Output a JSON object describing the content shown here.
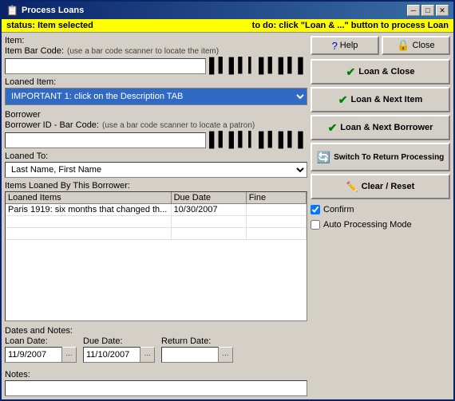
{
  "window": {
    "title": "Process Loans",
    "title_icon": "📋"
  },
  "status": {
    "left": "status: Item selected",
    "right": "to do: click \"Loan & ...\" button to process Loan"
  },
  "item_section": {
    "label": "Item:",
    "barcode_label": "Item Bar Code:",
    "barcode_note": "(use a bar code scanner to locate the item)",
    "barcode_value": "",
    "barcode_icon": "▌▌▌▌▌▌▌▌▌▌"
  },
  "loaned_item": {
    "label": "Loaned Item:",
    "value": "IMPORTANT 1:   click on the Description TAB"
  },
  "borrower_section": {
    "label": "Borrower",
    "barcode_label": "Borrower ID - Bar Code:",
    "barcode_note": "(use a bar code scanner to locate a patron)",
    "barcode_value": "",
    "loaned_to_label": "Loaned To:",
    "loaned_to_placeholder": "Last Name, First Name",
    "loaned_to_value": ""
  },
  "items_table": {
    "section_label": "Items Loaned By This Borrower:",
    "columns": [
      "Loaned Items",
      "Due Date",
      "Fine"
    ],
    "rows": [
      {
        "item": "Paris 1919: six months that changed th...",
        "due_date": "10/30/2007",
        "fine": ""
      }
    ]
  },
  "dates_section": {
    "label": "Dates and Notes:",
    "loan_date_label": "Loan Date:",
    "loan_date_value": "11/9/2007",
    "due_date_label": "Due Date:",
    "due_date_value": "11/10/2007",
    "return_date_label": "Return Date:",
    "return_date_value": "",
    "notes_label": "Notes:",
    "notes_value": ""
  },
  "buttons": {
    "help": "Help",
    "close": "Close",
    "loan_and_close": "Loan & Close",
    "loan_and_next_item": "Loan & Next Item",
    "loan_and_next_borrower": "Loan & Next Borrower",
    "switch_to_return": "Switch To Return Processing",
    "clear_reset": "Clear / Reset"
  },
  "checkboxes": {
    "confirm_label": "Confirm",
    "confirm_checked": true,
    "auto_processing_label": "Auto Processing Mode",
    "auto_processing_checked": false
  },
  "titlebar_buttons": {
    "minimize": "─",
    "maximize": "□",
    "close": "✕"
  }
}
